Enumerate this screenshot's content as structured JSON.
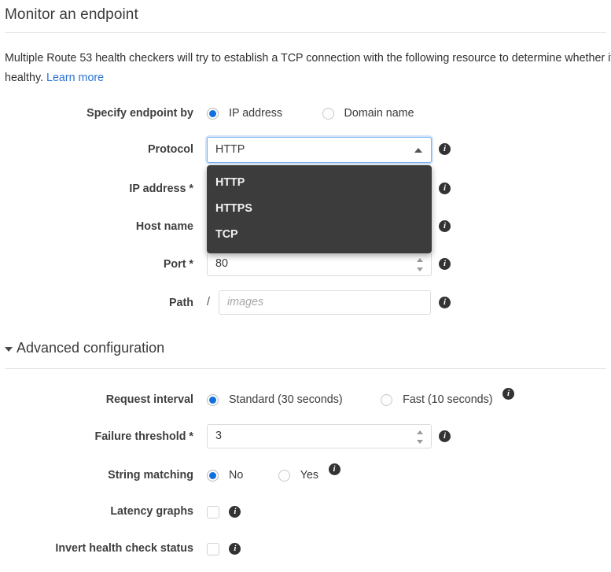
{
  "page": {
    "title": "Monitor an endpoint",
    "description_part1": "Multiple Route 53 health checkers will try to establish a TCP connection with the following resource to determine whether it's healthy. ",
    "description_link": "Learn more"
  },
  "form": {
    "specify_endpoint_by": {
      "label": "Specify endpoint by",
      "options": [
        {
          "label": "IP address",
          "selected": true
        },
        {
          "label": "Domain name",
          "selected": false
        }
      ]
    },
    "protocol": {
      "label": "Protocol",
      "value": "HTTP",
      "expanded": true,
      "options": [
        "HTTP",
        "HTTPS",
        "TCP"
      ],
      "info": "i"
    },
    "ip_address": {
      "label": "IP address *",
      "value": "",
      "info": "i"
    },
    "host_name": {
      "label": "Host name",
      "value": "",
      "info": "i"
    },
    "port": {
      "label": "Port *",
      "value": "80",
      "info": "i"
    },
    "path": {
      "label": "Path",
      "prefix": "/",
      "value": "",
      "placeholder": "images",
      "info": "i"
    }
  },
  "advanced": {
    "header": "Advanced configuration",
    "expanded": true,
    "request_interval": {
      "label": "Request interval",
      "options": [
        {
          "label": "Standard (30 seconds)",
          "selected": true
        },
        {
          "label": "Fast (10 seconds)",
          "selected": false
        }
      ],
      "info": "i"
    },
    "failure_threshold": {
      "label": "Failure threshold *",
      "value": "3",
      "info": "i"
    },
    "string_matching": {
      "label": "String matching",
      "options": [
        {
          "label": "No",
          "selected": true
        },
        {
          "label": "Yes",
          "selected": false
        }
      ],
      "info": "i"
    },
    "latency_graphs": {
      "label": "Latency graphs",
      "checked": false,
      "info": "i"
    },
    "invert_health_check_status": {
      "label": "Invert health check status",
      "checked": false,
      "info": "i"
    }
  },
  "colors": {
    "accent_blue": "#1170de",
    "link_blue": "#2a74d4",
    "dropdown_bg": "#3c3c3c",
    "focus_ring": "#7eb3ef"
  }
}
